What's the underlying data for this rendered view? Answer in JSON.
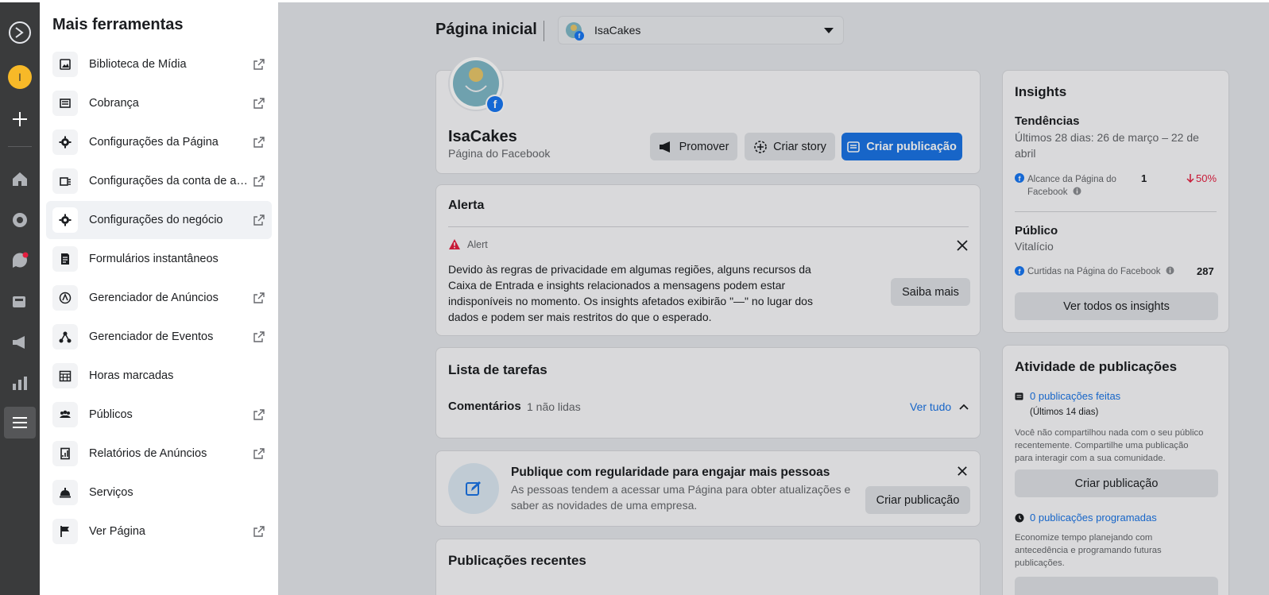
{
  "panel": {
    "title": "Mais ferramentas",
    "items": [
      {
        "label": "Biblioteca de Mídia",
        "external": true,
        "icon": "media-library-icon"
      },
      {
        "label": "Cobrança",
        "external": true,
        "icon": "billing-icon"
      },
      {
        "label": "Configurações da Página",
        "external": true,
        "icon": "gear-icon"
      },
      {
        "label": "Configurações da conta de anúncios",
        "external": true,
        "icon": "ad-account-icon"
      },
      {
        "label": "Configurações do negócio",
        "external": true,
        "icon": "gear-icon"
      },
      {
        "label": "Formulários instantâneos",
        "external": false,
        "icon": "form-icon"
      },
      {
        "label": "Gerenciador de Anúncios",
        "external": true,
        "icon": "ads-manager-icon"
      },
      {
        "label": "Gerenciador de Eventos",
        "external": true,
        "icon": "events-manager-icon"
      },
      {
        "label": "Horas marcadas",
        "external": false,
        "icon": "calendar-icon"
      },
      {
        "label": "Públicos",
        "external": true,
        "icon": "audiences-icon"
      },
      {
        "label": "Relatórios de Anúncios",
        "external": true,
        "icon": "reports-icon"
      },
      {
        "label": "Serviços",
        "external": false,
        "icon": "service-bell-icon"
      },
      {
        "label": "Ver Página",
        "external": true,
        "icon": "flag-icon"
      }
    ]
  },
  "rail": {
    "avatar_letter": "I",
    "items": [
      "meta-logo-icon",
      "avatar",
      "plus-icon",
      "home-icon",
      "messenger-icon",
      "inbox-icon",
      "posts-icon",
      "megaphone-icon",
      "insights-icon",
      "menu-icon"
    ]
  },
  "header": {
    "title": "Página inicial",
    "page_selector": "IsaCakes"
  },
  "profile": {
    "name": "IsaCakes",
    "subtitle": "Página do Facebook",
    "promote": "Promover",
    "story": "Criar story",
    "create_post": "Criar publicação"
  },
  "alert": {
    "heading": "Alerta",
    "tag": "Alert",
    "text_lines": [
      "Devido às regras de privacidade em algumas regiões, alguns recursos da",
      "Caixa de Entrada e insights relacionados a mensagens podem estar",
      "indisponíveis no momento. Os insights afetados exibirão \"—\" no lugar dos",
      "dados e podem ser mais restritos do que o esperado."
    ],
    "learn_more": "Saiba mais"
  },
  "tasks": {
    "heading": "Lista de tarefas",
    "comments_label": "Comentários",
    "unread": "1 não lidas",
    "see_all": "Ver tudo"
  },
  "tip": {
    "title": "Publique com regularidade para engajar mais pessoas",
    "line1": "As pessoas tendem a acessar uma Página para obter atualizações e",
    "line2": "saber as novidades de uma empresa.",
    "button": "Criar publicação"
  },
  "recent": {
    "heading": "Publicações recentes"
  },
  "insights": {
    "heading": "Insights",
    "trends": "Tendências",
    "period_line1": "Últimos 28 dias: 26 de março – 22 de",
    "period_line2": "abril",
    "reach_line1": "Alcance da Página do",
    "reach_line2": "Facebook",
    "reach_value": "1",
    "reach_change": "50%",
    "audience": "Público",
    "lifetime": "Vitalício",
    "likes_label": "Curtidas na Página do Facebook",
    "likes_value": "287",
    "see_all": "Ver todos os insights"
  },
  "activity": {
    "heading": "Atividade de publicações",
    "posts_made": "0 publicações feitas",
    "last14": "(Últimos 14 dias)",
    "desc_line1": "Você não compartilhou nada com o seu público",
    "desc_line2": "recentemente. Compartilhe uma publicação",
    "desc_line3": "para interagir com a sua comunidade.",
    "create_post": "Criar publicação",
    "scheduled": "0 publicações programadas",
    "sched_line1": "Economize tempo planejando com",
    "sched_line2": "antecedência e programando futuras",
    "sched_line3": "publicações."
  },
  "colors": {
    "rail": "#3a3b3c",
    "accent": "#1b74e4",
    "negative": "#e41e3f",
    "avatar": "#f7b928"
  }
}
